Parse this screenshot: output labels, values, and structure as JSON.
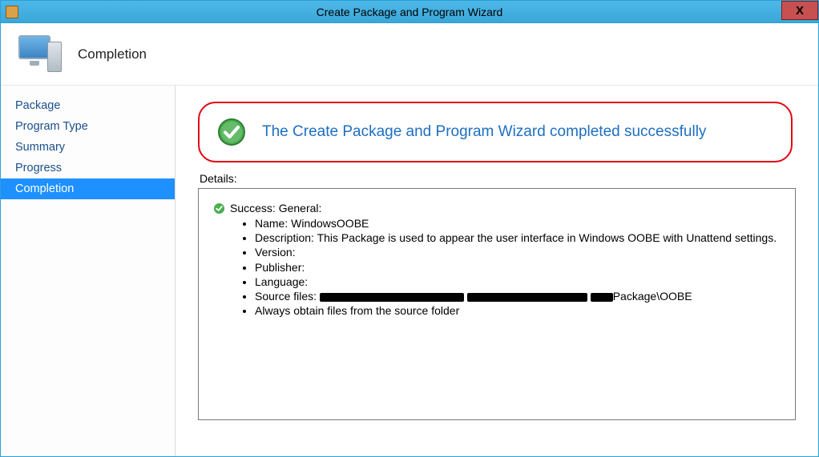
{
  "window": {
    "title": "Create Package and Program Wizard",
    "close_label": "X"
  },
  "header": {
    "title": "Completion"
  },
  "sidebar": {
    "items": [
      {
        "label": "Package",
        "active": false
      },
      {
        "label": "Program Type",
        "active": false
      },
      {
        "label": "Summary",
        "active": false
      },
      {
        "label": "Progress",
        "active": false
      },
      {
        "label": "Completion",
        "active": true
      }
    ]
  },
  "content": {
    "success_message": "The Create Package and Program Wizard completed successfully",
    "details_label": "Details:",
    "detail_header": "Success: General:",
    "details": {
      "name_label": "Name: ",
      "name_value": "WindowsOOBE",
      "description_label": "Description: ",
      "description_value": "This Package is used to appear the user interface in Windows OOBE with Unattend settings.",
      "version_label": "Version:",
      "publisher_label": "Publisher:",
      "language_label": "Language:",
      "source_files_label": "Source files: ",
      "source_files_suffix": "Package\\OOBE",
      "always_obtain": "Always obtain files from the source folder"
    }
  }
}
